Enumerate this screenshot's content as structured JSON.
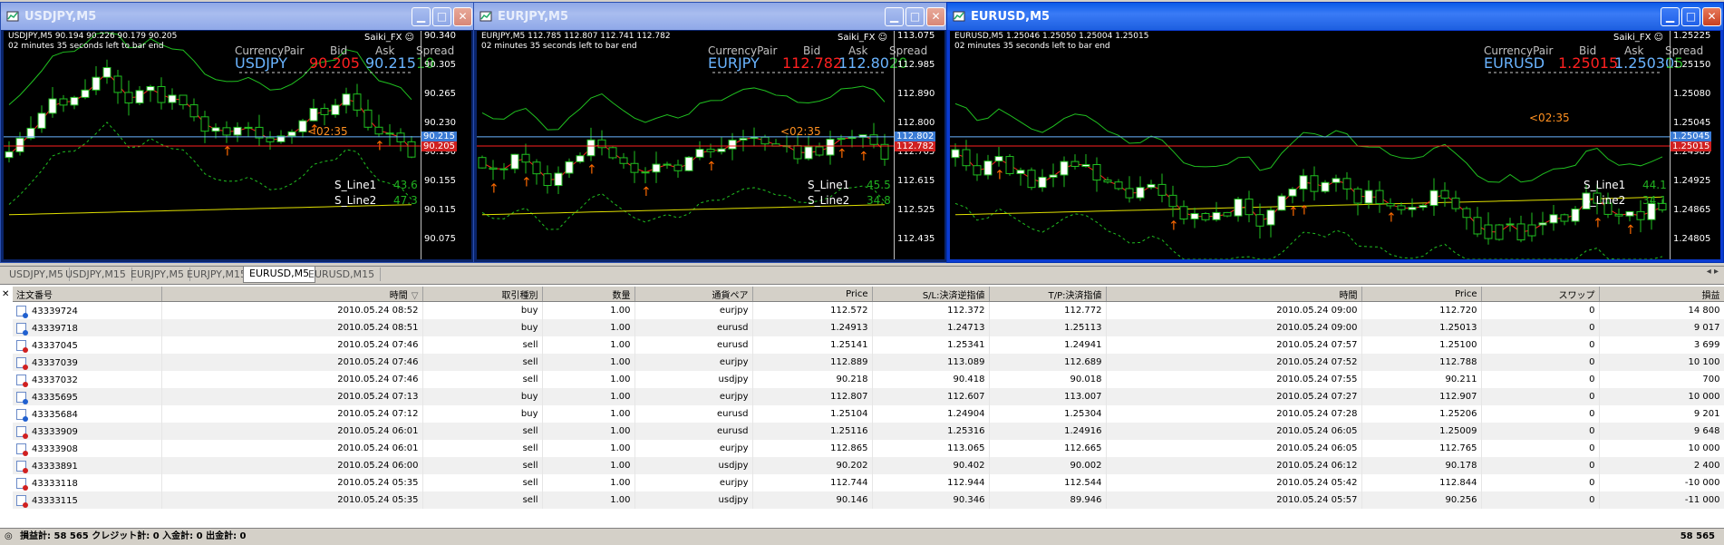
{
  "colors": {
    "bid": "#ff2020",
    "ask": "#6ab4ff",
    "spread": "#20b020",
    "ma": "#ff2020",
    "env": "#20c020",
    "long_ma": "#e0e000",
    "arrow": "#ff6a00",
    "buy_icon": "#2060d0",
    "sell_icon": "#d02020"
  },
  "windows": [
    {
      "title": "USDJPY,M5",
      "ohlc": "USDJPY,M5  90.194 90.226 90.179 90.205",
      "countdown": "02 minutes 35 seconds left to bar end",
      "broker": "Saiki_FX ☺",
      "quote": {
        "head_pair": "CurrencyPair",
        "head_bid": "Bid",
        "head_ask": "Ask",
        "head_spread": "Spread",
        "pair": "USDJPY",
        "bid": "90.205",
        "ask": "90.215",
        "spread": "10"
      },
      "s_line1_label": "S_Line1",
      "s_line1": "43.6",
      "s_line2_label": "S_Line2",
      "s_line2": "47.3",
      "timer": "<02:35",
      "yticks": [
        "90.340",
        "90.305",
        "90.265",
        "90.230",
        "90.190",
        "90.155",
        "90.115",
        "90.075"
      ],
      "price_ask_tag": "90.215",
      "price_bid_tag": "90.205",
      "active": false,
      "seed": 3
    },
    {
      "title": "EURJPY,M5",
      "ohlc": "EURJPY,M5  112.785 112.807 112.741 112.782",
      "countdown": "02 minutes 35 seconds left to bar end",
      "broker": "Saiki_FX ☺",
      "quote": {
        "head_pair": "CurrencyPair",
        "head_bid": "Bid",
        "head_ask": "Ask",
        "head_spread": "Spread",
        "pair": "EURJPY",
        "bid": "112.782",
        "ask": "112.802",
        "spread": "20"
      },
      "s_line1_label": "S_Line1",
      "s_line1": "45.5",
      "s_line2_label": "S_Line2",
      "s_line2": "34.8",
      "timer": "<02:35",
      "yticks": [
        "113.075",
        "112.985",
        "112.890",
        "112.800",
        "112.705",
        "112.615",
        "112.525",
        "112.435"
      ],
      "price_ask_tag": "112.802",
      "price_bid_tag": "112.782",
      "active": false,
      "seed": 7
    },
    {
      "title": "EURUSD,M5",
      "ohlc": "EURUSD,M5  1.25046 1.25050 1.25004 1.25015",
      "countdown": "02 minutes 35 seconds left to bar end",
      "broker": "Saiki_FX ☺",
      "quote": {
        "head_pair": "CurrencyPair",
        "head_bid": "Bid",
        "head_ask": "Ask",
        "head_spread": "Spread",
        "pair": "EURUSD",
        "bid": "1.25015",
        "ask": "1.25030",
        "spread": "15"
      },
      "s_line1_label": "S_Line1",
      "s_line1": "44.1",
      "s_line2_label": "S_Line2",
      "s_line2": "34.1",
      "timer": "<02:35",
      "yticks": [
        "1.25225",
        "1.25150",
        "1.25080",
        "1.25045",
        "1.24985",
        "1.24925",
        "1.24865",
        "1.24805"
      ],
      "price_ask_tag": "1.25045",
      "price_bid_tag": "1.25015",
      "active": true,
      "seed": 11
    }
  ],
  "tabs": [
    "USDJPY,M5",
    "USDJPY,M15",
    "EURJPY,M5",
    "EURJPY,M15",
    "EURUSD,M5",
    "EURUSD,M15"
  ],
  "selected_tab": 4,
  "nav_arrows": "◂ ▸",
  "table": {
    "headers": [
      "注文番号",
      "時間",
      "取引種別",
      "数量",
      "通貨ペア",
      "Price",
      "S/L:決済逆指値",
      "T/P:決済指値",
      "時間",
      "Price",
      "スワップ",
      "損益"
    ],
    "sort_mark": "▽",
    "rows": [
      [
        "43339724",
        "2010.05.24 08:52",
        "buy",
        "1.00",
        "eurjpy",
        "112.572",
        "112.372",
        "112.772",
        "2010.05.24 09:00",
        "112.720",
        "0",
        "14 800"
      ],
      [
        "43339718",
        "2010.05.24 08:51",
        "buy",
        "1.00",
        "eurusd",
        "1.24913",
        "1.24713",
        "1.25113",
        "2010.05.24 09:00",
        "1.25013",
        "0",
        "9 017"
      ],
      [
        "43337045",
        "2010.05.24 07:46",
        "sell",
        "1.00",
        "eurusd",
        "1.25141",
        "1.25341",
        "1.24941",
        "2010.05.24 07:57",
        "1.25100",
        "0",
        "3 699"
      ],
      [
        "43337039",
        "2010.05.24 07:46",
        "sell",
        "1.00",
        "eurjpy",
        "112.889",
        "113.089",
        "112.689",
        "2010.05.24 07:52",
        "112.788",
        "0",
        "10 100"
      ],
      [
        "43337032",
        "2010.05.24 07:46",
        "sell",
        "1.00",
        "usdjpy",
        "90.218",
        "90.418",
        "90.018",
        "2010.05.24 07:55",
        "90.211",
        "0",
        "700"
      ],
      [
        "43335695",
        "2010.05.24 07:13",
        "buy",
        "1.00",
        "eurjpy",
        "112.807",
        "112.607",
        "113.007",
        "2010.05.24 07:27",
        "112.907",
        "0",
        "10 000"
      ],
      [
        "43335684",
        "2010.05.24 07:12",
        "buy",
        "1.00",
        "eurusd",
        "1.25104",
        "1.24904",
        "1.25304",
        "2010.05.24 07:28",
        "1.25206",
        "0",
        "9 201"
      ],
      [
        "43333909",
        "2010.05.24 06:01",
        "sell",
        "1.00",
        "eurusd",
        "1.25116",
        "1.25316",
        "1.24916",
        "2010.05.24 06:05",
        "1.25009",
        "0",
        "9 648"
      ],
      [
        "43333908",
        "2010.05.24 06:01",
        "sell",
        "1.00",
        "eurjpy",
        "112.865",
        "113.065",
        "112.665",
        "2010.05.24 06:05",
        "112.765",
        "0",
        "10 000"
      ],
      [
        "43333891",
        "2010.05.24 06:00",
        "sell",
        "1.00",
        "usdjpy",
        "90.202",
        "90.402",
        "90.002",
        "2010.05.24 06:12",
        "90.178",
        "0",
        "2 400"
      ],
      [
        "43333118",
        "2010.05.24 05:35",
        "sell",
        "1.00",
        "eurjpy",
        "112.744",
        "112.944",
        "112.544",
        "2010.05.24 05:42",
        "112.844",
        "0",
        "-10 000"
      ],
      [
        "43333115",
        "2010.05.24 05:35",
        "sell",
        "1.00",
        "usdjpy",
        "90.146",
        "90.346",
        "89.946",
        "2010.05.24 05:57",
        "90.256",
        "0",
        "-11 000"
      ]
    ]
  },
  "status": {
    "summary": "損益計: 58 565  クレジット計: 0  入金計: 0  出金計: 0",
    "total": "58 565"
  }
}
